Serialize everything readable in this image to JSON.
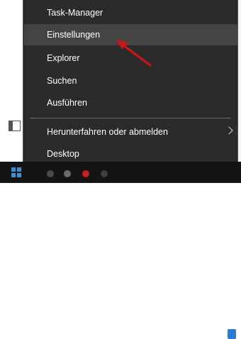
{
  "menu": {
    "items": [
      {
        "label": "Task-Manager"
      },
      {
        "label": "Einstellungen"
      },
      {
        "label": "Explorer"
      },
      {
        "label": "Suchen"
      },
      {
        "label": "Ausführen"
      },
      {
        "label": "Herunterfahren oder abmelden"
      },
      {
        "label": "Desktop"
      }
    ],
    "hovered": "Einstellungen",
    "submenu_indicator": "chevron-right-icon"
  },
  "colors": {
    "menu_bg": "#2b2b2b",
    "hover_bg": "#444444",
    "text": "#ffffff",
    "annotation_arrow": "#d0141a",
    "taskbar": "#141414"
  },
  "taskbar": {
    "start_icon": "windows-logo-icon"
  }
}
